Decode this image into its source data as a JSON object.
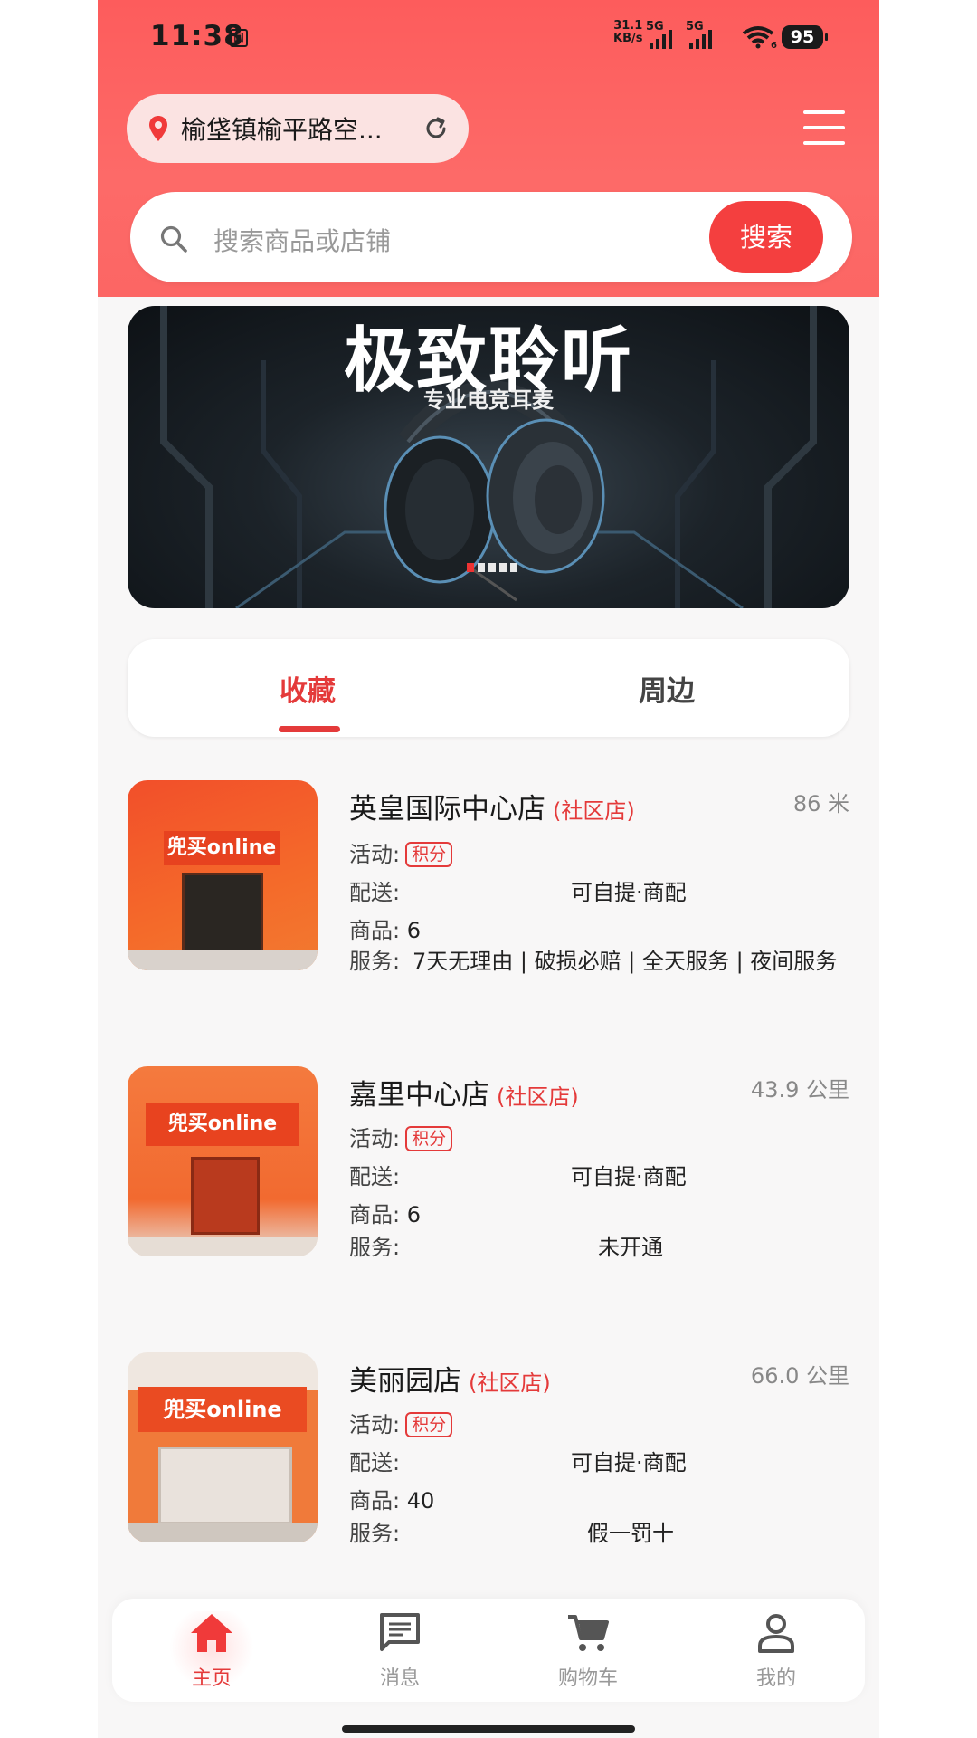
{
  "status_bar": {
    "time": "11:38",
    "sim_label": "回",
    "net_speed_value": "31.1",
    "net_speed_unit": "KB/s",
    "signal1_label": "5G",
    "signal2_label": "5G",
    "wifi_label": "6",
    "battery": "95"
  },
  "header": {
    "location": "榆垡镇榆平路空...",
    "location_icon": "location-pin-icon",
    "refresh_icon": "refresh-icon",
    "menu_icon": "hamburger-menu-icon"
  },
  "search": {
    "placeholder": "搜索商品或店铺",
    "button": "搜索"
  },
  "banner": {
    "title": "极致聆听",
    "subtitle": "专业电竞耳麦",
    "slide_count": 5,
    "active_slide": 1
  },
  "tabs": {
    "items": [
      "收藏",
      "周边"
    ],
    "active": 0
  },
  "labels": {
    "activity": "活动:",
    "delivery": "配送:",
    "goods": "商品:",
    "service": "服务:"
  },
  "stores": [
    {
      "name": "英皇国际中心店",
      "kind": "(社区店)",
      "distance": "86 米",
      "activity_badge": "积分",
      "delivery": "可自提·商配",
      "goods": "6",
      "service": "7天无理由 | 破损必赔 | 全天服务 | 夜间服务",
      "sign": "兜买online"
    },
    {
      "name": "嘉里中心店",
      "kind": "(社区店)",
      "distance": "43.9 公里",
      "activity_badge": "积分",
      "delivery": "可自提·商配",
      "goods": "6",
      "service": "未开通",
      "sign": "兜买online"
    },
    {
      "name": "美丽园店",
      "kind": "(社区店)",
      "distance": "66.0 公里",
      "activity_badge": "积分",
      "delivery": "可自提·商配",
      "goods": "40",
      "service": "假一罚十",
      "sign": "兜买online"
    }
  ],
  "bottom_nav": {
    "items": [
      {
        "label": "主页",
        "icon": "home-icon"
      },
      {
        "label": "消息",
        "icon": "message-icon"
      },
      {
        "label": "购物车",
        "icon": "cart-icon"
      },
      {
        "label": "我的",
        "icon": "profile-icon"
      }
    ],
    "active": 0
  },
  "colors": {
    "brand_red": "#f43f3f",
    "header_gradient": "#fd5c5c",
    "accent_text": "#e43a3a"
  }
}
